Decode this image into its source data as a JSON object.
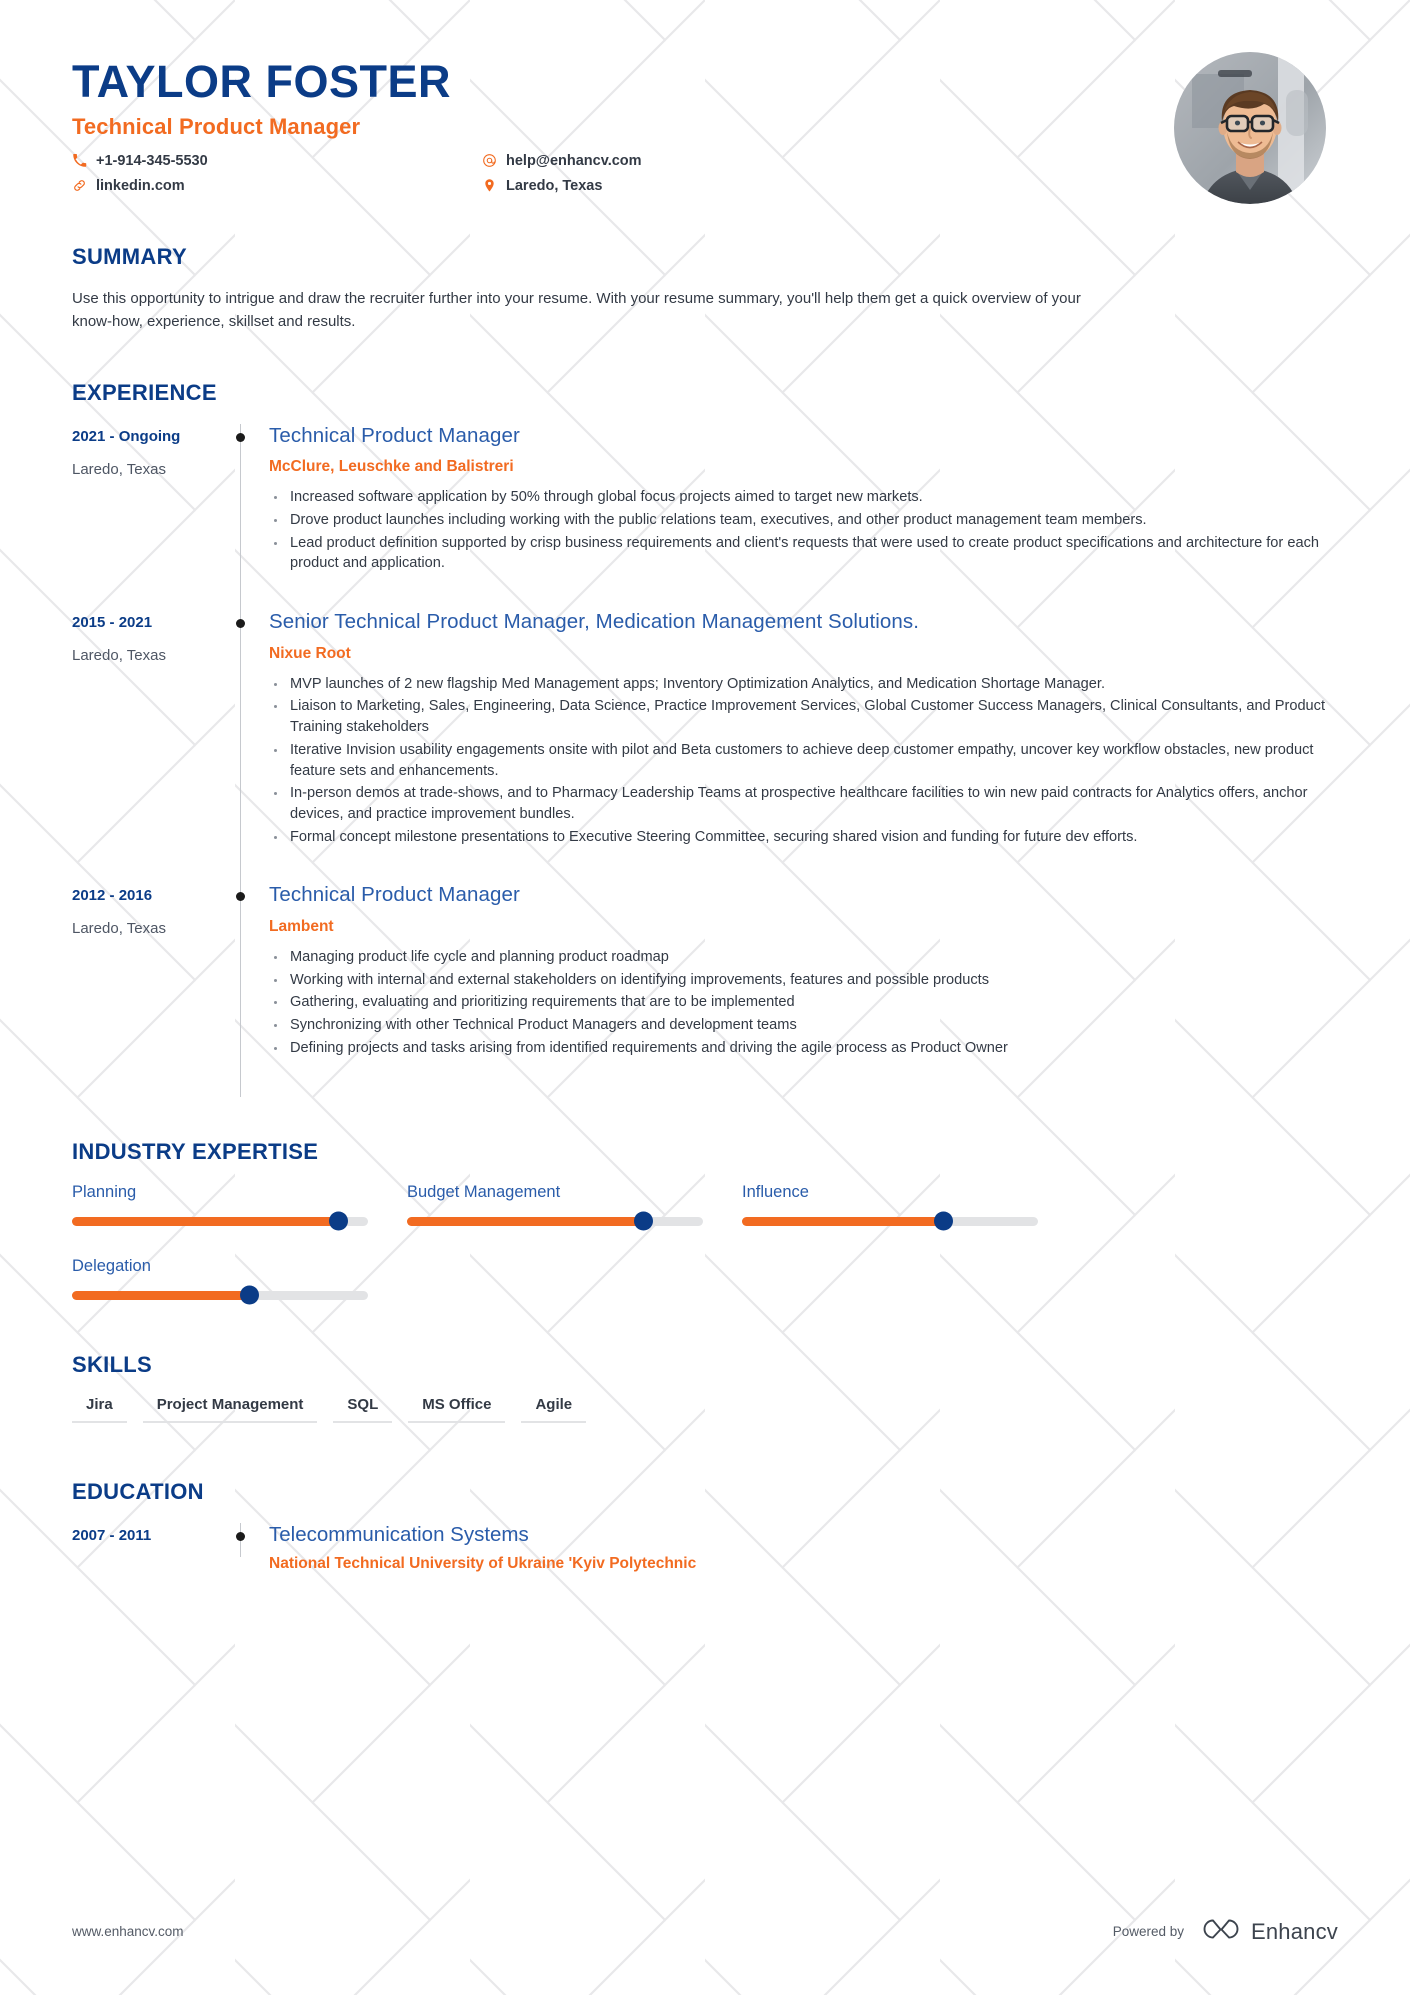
{
  "theme": {
    "navy": "#0b3c87",
    "orange": "#f26b21",
    "link_blue": "#2a5caa",
    "body_text": "#333a45",
    "track_gray": "#e2e3e5"
  },
  "header": {
    "full_name": "TAYLOR FOSTER",
    "job_title": "Technical Product Manager",
    "contacts": [
      {
        "icon": "phone-icon",
        "value": "+1-914-345-5530"
      },
      {
        "icon": "email-icon",
        "value": "help@enhancv.com"
      },
      {
        "icon": "link-icon",
        "value": "linkedin.com"
      },
      {
        "icon": "location-pin-icon",
        "value": "Laredo, Texas"
      }
    ],
    "avatar_alt": "profile-photo"
  },
  "summary": {
    "title": "SUMMARY",
    "text": "Use this opportunity to intrigue and draw the recruiter further into your resume. With your resume summary, you'll help them get a quick overview of your know-how, experience, skillset and results."
  },
  "experience": {
    "title": "EXPERIENCE",
    "entries": [
      {
        "dates": "2021 - Ongoing",
        "location": "Laredo, Texas",
        "role": "Technical Product Manager",
        "company": "McClure, Leuschke and Balistreri",
        "bullets": [
          "Increased software application by 50% through global focus projects aimed to target new markets.",
          "Drove product launches including working with the public relations team, executives, and other product management team members.",
          "Lead product definition supported by crisp business requirements and client's requests that were used to create product specifications and architecture for each product and application."
        ]
      },
      {
        "dates": "2015 - 2021",
        "location": "Laredo, Texas",
        "role": "Senior Technical Product Manager, Medication Management Solutions.",
        "company": "Nixue Root",
        "bullets": [
          "MVP launches of 2 new flagship Med Management apps; Inventory Optimization Analytics, and Medication Shortage Manager.",
          "Liaison to Marketing, Sales, Engineering, Data Science, Practice Improvement Services, Global Customer Success Managers, Clinical Consultants, and Product Training stakeholders",
          "Iterative Invision usability engagements onsite with pilot and Beta customers to achieve deep customer empathy, uncover key workflow obstacles, new product feature sets and enhancements.",
          "In-person demos at trade-shows, and to Pharmacy Leadership Teams at prospective healthcare facilities to win new paid contracts for Analytics offers, anchor devices, and practice improvement bundles.",
          "Formal concept milestone presentations to Executive Steering Committee, securing shared vision and funding for future dev efforts."
        ]
      },
      {
        "dates": "2012 - 2016",
        "location": "Laredo, Texas",
        "role": "Technical Product Manager",
        "company": "Lambent",
        "bullets": [
          "Managing product life cycle and planning product roadmap",
          "Working with internal and external stakeholders on identifying improvements, features and possible products",
          "Gathering, evaluating and prioritizing requirements that are to be implemented",
          "Synchronizing with other Technical Product Managers and development teams",
          "Defining projects and tasks arising from identified requirements and driving the agile process as Product Owner"
        ]
      }
    ]
  },
  "expertise": {
    "title": "INDUSTRY EXPERTISE",
    "items": [
      {
        "label": "Planning",
        "percent": 90
      },
      {
        "label": "Budget Management",
        "percent": 80
      },
      {
        "label": "Influence",
        "percent": 68
      },
      {
        "label": "Delegation",
        "percent": 60
      }
    ]
  },
  "skills": {
    "title": "SKILLS",
    "items": [
      "Jira",
      "Project Management",
      "SQL",
      "MS Office",
      "Agile"
    ]
  },
  "education": {
    "title": "EDUCATION",
    "entries": [
      {
        "dates": "2007 - 2011",
        "degree": "Telecommunication Systems",
        "school": "National Technical University of Ukraine 'Kyiv Polytechnic"
      }
    ]
  },
  "footer": {
    "url": "www.enhancv.com",
    "powered_by": "Powered by",
    "brand_name": "Enhancv",
    "brand_logo": "enhancv-infinity-logo"
  }
}
